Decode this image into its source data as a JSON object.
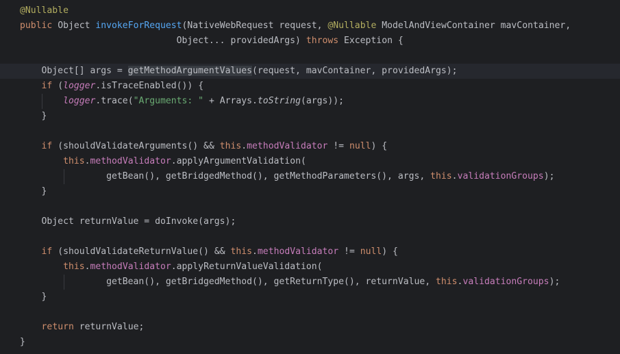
{
  "editor": {
    "lines": [
      [
        {
          "t": "@Nullable",
          "c": "ann"
        }
      ],
      [
        {
          "t": "public",
          "c": "kw"
        },
        {
          "t": " Object "
        },
        {
          "t": "invokeForRequest",
          "c": "fn"
        },
        {
          "t": "(NativeWebRequest request, "
        },
        {
          "t": "@Nullable",
          "c": "ann"
        },
        {
          "t": " ModelAndViewContainer mavContainer,"
        }
      ],
      [
        {
          "t": "                             Object... providedArgs) "
        },
        {
          "t": "throws",
          "c": "kw"
        },
        {
          "t": " Exception {"
        }
      ],
      [],
      [
        {
          "t": "    Object[] args = "
        },
        {
          "t": "getMethodArgumentValues",
          "c": "hl"
        },
        {
          "t": "(request, mavContainer, providedArgs);"
        }
      ],
      [
        {
          "t": "    "
        },
        {
          "t": "if",
          "c": "kw"
        },
        {
          "t": " ("
        },
        {
          "t": "logger",
          "c": "logf"
        },
        {
          "t": ".isTraceEnabled()) {"
        }
      ],
      [
        {
          "t": "        "
        },
        {
          "t": "logger",
          "c": "logf"
        },
        {
          "t": ".trace("
        },
        {
          "t": "\"Arguments: \"",
          "c": "str"
        },
        {
          "t": " + Arrays."
        },
        {
          "t": "toString",
          "c": "stat"
        },
        {
          "t": "(args));"
        }
      ],
      [
        {
          "t": "    }"
        }
      ],
      [],
      [
        {
          "t": "    "
        },
        {
          "t": "if",
          "c": "kw"
        },
        {
          "t": " (shouldValidateArguments() && "
        },
        {
          "t": "this",
          "c": "kw"
        },
        {
          "t": "."
        },
        {
          "t": "methodValidator",
          "c": "fld"
        },
        {
          "t": " != "
        },
        {
          "t": "null",
          "c": "kw"
        },
        {
          "t": ") {"
        }
      ],
      [
        {
          "t": "        "
        },
        {
          "t": "this",
          "c": "kw"
        },
        {
          "t": "."
        },
        {
          "t": "methodValidator",
          "c": "fld"
        },
        {
          "t": ".applyArgumentValidation("
        }
      ],
      [
        {
          "t": "                getBean(), getBridgedMethod(), getMethodParameters(), args, "
        },
        {
          "t": "this",
          "c": "kw"
        },
        {
          "t": "."
        },
        {
          "t": "validationGroups",
          "c": "fld"
        },
        {
          "t": ");"
        }
      ],
      [
        {
          "t": "    }"
        }
      ],
      [],
      [
        {
          "t": "    Object returnValue = doInvoke(args);"
        }
      ],
      [],
      [
        {
          "t": "    "
        },
        {
          "t": "if",
          "c": "kw"
        },
        {
          "t": " (shouldValidateReturnValue() && "
        },
        {
          "t": "this",
          "c": "kw"
        },
        {
          "t": "."
        },
        {
          "t": "methodValidator",
          "c": "fld"
        },
        {
          "t": " != "
        },
        {
          "t": "null",
          "c": "kw"
        },
        {
          "t": ") {"
        }
      ],
      [
        {
          "t": "        "
        },
        {
          "t": "this",
          "c": "kw"
        },
        {
          "t": "."
        },
        {
          "t": "methodValidator",
          "c": "fld"
        },
        {
          "t": ".applyReturnValueValidation("
        }
      ],
      [
        {
          "t": "                getBean(), getBridgedMethod(), getReturnType(), returnValue, "
        },
        {
          "t": "this",
          "c": "kw"
        },
        {
          "t": "."
        },
        {
          "t": "validationGroups",
          "c": "fld"
        },
        {
          "t": ");"
        }
      ],
      [
        {
          "t": "    }"
        }
      ],
      [],
      [
        {
          "t": "    "
        },
        {
          "t": "return",
          "c": "kw"
        },
        {
          "t": " returnValue;"
        }
      ],
      [
        {
          "t": "}"
        }
      ]
    ]
  },
  "theme": {
    "background": "#1e1f22",
    "current_line": "#26282e",
    "keyword": "#cf8e6d",
    "annotation": "#b3ae60",
    "method_declaration": "#56a8f5",
    "field": "#c77dbb",
    "string": "#6aab73",
    "default_text": "#bcbec4"
  }
}
